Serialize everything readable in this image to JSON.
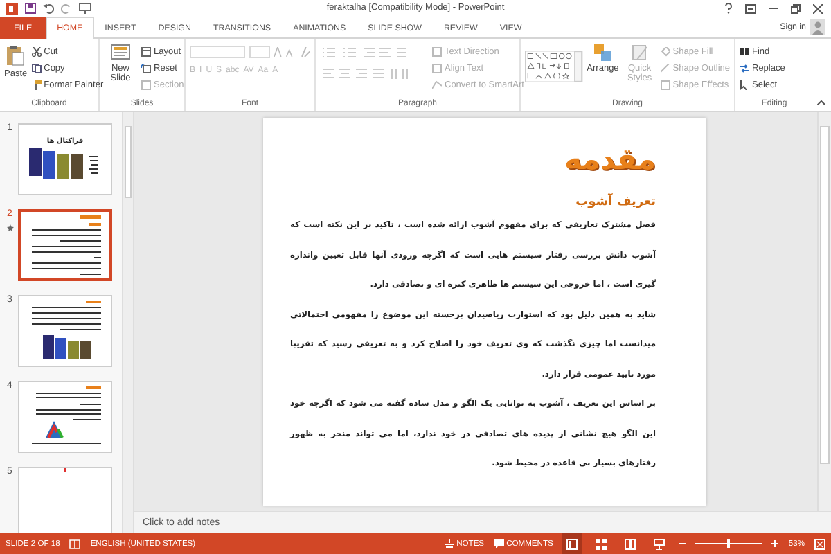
{
  "window": {
    "title": "feraktalha [Compatibility Mode] - PowerPoint"
  },
  "tabs": [
    {
      "label": "FILE",
      "kind": "file",
      "selected": false
    },
    {
      "label": "HOME",
      "kind": "tab",
      "selected": true
    },
    {
      "label": "INSERT",
      "kind": "tab",
      "selected": false
    },
    {
      "label": "DESIGN",
      "kind": "tab",
      "selected": false
    },
    {
      "label": "TRANSITIONS",
      "kind": "tab",
      "selected": false
    },
    {
      "label": "ANIMATIONS",
      "kind": "tab",
      "selected": false
    },
    {
      "label": "SLIDE SHOW",
      "kind": "tab",
      "selected": false
    },
    {
      "label": "REVIEW",
      "kind": "tab",
      "selected": false
    },
    {
      "label": "VIEW",
      "kind": "tab",
      "selected": false
    }
  ],
  "account": {
    "label": "Sign in"
  },
  "ribbon": {
    "clipboard": {
      "label": "Clipboard",
      "paste": {
        "label": "Paste",
        "disabled": false
      },
      "cut": {
        "label": "Cut",
        "disabled": false
      },
      "copy": {
        "label": "Copy",
        "disabled": false
      },
      "format_painter": {
        "label": "Format Painter",
        "disabled": false
      }
    },
    "slides": {
      "label": "Slides",
      "new_slide": {
        "label": "New Slide",
        "disabled": false
      },
      "layout": {
        "label": "Layout",
        "disabled": false
      },
      "reset": {
        "label": "Reset",
        "disabled": false
      },
      "section": {
        "label": "Section",
        "disabled": true
      }
    },
    "font": {
      "label": "Font",
      "disabled": true,
      "buttons": [
        "B",
        "I",
        "U",
        "S",
        "abc",
        "AV",
        "Aa",
        "A"
      ]
    },
    "paragraph": {
      "label": "Paragraph",
      "text_direction": {
        "label": "Text Direction",
        "disabled": true
      },
      "align_text": {
        "label": "Align Text",
        "disabled": true
      },
      "convert_smartart": {
        "label": "Convert to SmartArt",
        "disabled": true
      }
    },
    "drawing": {
      "label": "Drawing",
      "arrange": {
        "label": "Arrange",
        "disabled": false
      },
      "quick_styles": {
        "label": "Quick Styles",
        "disabled": true
      },
      "shape_fill": {
        "label": "Shape Fill",
        "disabled": true
      },
      "shape_outline": {
        "label": "Shape Outline",
        "disabled": true
      },
      "shape_effects": {
        "label": "Shape Effects",
        "disabled": true
      }
    },
    "editing": {
      "label": "Editing",
      "find": {
        "label": "Find",
        "disabled": false
      },
      "replace": {
        "label": "Replace",
        "disabled": false
      },
      "select": {
        "label": "Select",
        "disabled": false
      }
    }
  },
  "thumbnails": [
    {
      "number": "1",
      "kind": "title-photos",
      "title": "فراکتال ها",
      "selected": false,
      "animated": false
    },
    {
      "number": "2",
      "kind": "text",
      "selected": true,
      "animated": true
    },
    {
      "number": "3",
      "kind": "text-photos",
      "selected": false,
      "animated": false
    },
    {
      "number": "4",
      "kind": "text-logo",
      "selected": false,
      "animated": false
    },
    {
      "number": "5",
      "kind": "partial",
      "selected": false,
      "animated": false
    }
  ],
  "slide": {
    "title": "مقدمه",
    "subtitle": "تعریف آشوب",
    "paragraphs": [
      "فصل مشترک تعاریفی که برای مفهوم آشوب ارائه شده است ، تاکید بر این نکته است که آشوب دانش بررسی رفتار سیستم هایی است که اگرچه ورودی آنها قابل تعیین واندازه گیری است ، اما خروجی این سیستم ها ظاهری کتره ای و تصادفی دارد.",
      "شاید به همین دلیل بود که استوارت ریاضیدان برجسته این موضوع را مفهومی احتمالاتی میدانست اما چیزی نگذشت که وی تعریف خود را اصلاح کرد و به تعریفی رسید که تقریبا مورد تایید عمومی قرار دارد.",
      "بر اساس این تعریف ، آشوب به توانایی یک الگو و مدل ساده گفته می شود که اگرچه خود این الگو هیچ نشانی از پدیده های تصادفی در خود ندارد، اما می تواند منجر به ظهور رفتارهای بسیار بی قاعده در محیط شود."
    ]
  },
  "notes": {
    "placeholder": "Click to add notes"
  },
  "status_bar": {
    "slide_indicator": "SLIDE 2 OF 18",
    "language": "ENGLISH (UNITED STATES)",
    "notes": "NOTES",
    "comments": "COMMENTS",
    "views": [
      {
        "kind": "normal",
        "selected": true
      },
      {
        "kind": "sorter",
        "selected": false
      },
      {
        "kind": "reading",
        "selected": false
      },
      {
        "kind": "slideshow",
        "selected": false
      }
    ],
    "zoom": {
      "level": 0.5,
      "reading": "53%"
    }
  }
}
